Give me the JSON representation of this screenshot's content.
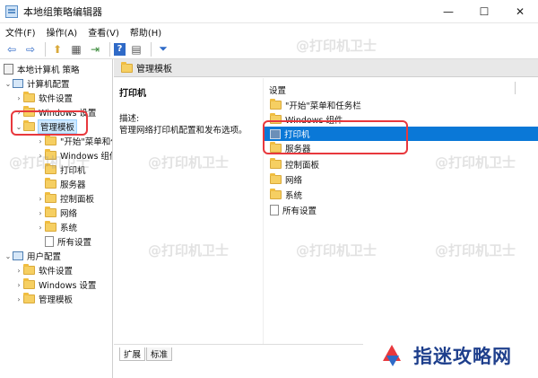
{
  "window": {
    "title": "本地组策略编辑器",
    "controls": {
      "minimize": "—",
      "maximize": "☐",
      "close": "✕"
    }
  },
  "menu": [
    "文件(F)",
    "操作(A)",
    "查看(V)",
    "帮助(H)"
  ],
  "toolbar": {
    "icons": [
      "back-arrow-icon",
      "forward-arrow-icon",
      "up-folder-icon",
      "show-tree-icon",
      "export-icon",
      "help-icon",
      "properties-icon",
      "filter-icon"
    ],
    "glyphs": [
      "⇦",
      "⇨",
      "⬆",
      "▦",
      "⇥",
      "?",
      "▤",
      "⏷"
    ]
  },
  "tree": {
    "root": "本地计算机 策略",
    "computer_config": "计算机配置",
    "software_settings": "软件设置",
    "windows_settings": "Windows 设置",
    "admin_templates": "管理模板",
    "admin_children": [
      "\"开始\"菜单和任务栏",
      "Windows 组件",
      "打印机",
      "服务器",
      "控制面板",
      "网络",
      "系统",
      "所有设置"
    ],
    "user_config": "用户配置",
    "user_software_settings": "软件设置",
    "user_windows_settings": "Windows 设置",
    "user_admin_templates": "管理模板"
  },
  "header": {
    "title": "管理模板"
  },
  "description": {
    "item_title": "打印机",
    "label": "描述:",
    "text": "管理网络打印机配置和发布选项。"
  },
  "list": {
    "column": "设置",
    "items": [
      "\"开始\"菜单和任务栏",
      "Windows 组件",
      "打印机",
      "服务器",
      "控制面板",
      "网络",
      "系统",
      "所有设置"
    ],
    "selected_index": 2
  },
  "tabs": {
    "extended": "扩展",
    "standard": "标准"
  },
  "watermark": "@打印机卫士",
  "brand": {
    "name": "指迷攻略网"
  },
  "colors": {
    "selection": "#0a78d7",
    "highlight": "#e8383d",
    "folder": "#f6cf62",
    "brand_text": "#1e3f8c"
  }
}
